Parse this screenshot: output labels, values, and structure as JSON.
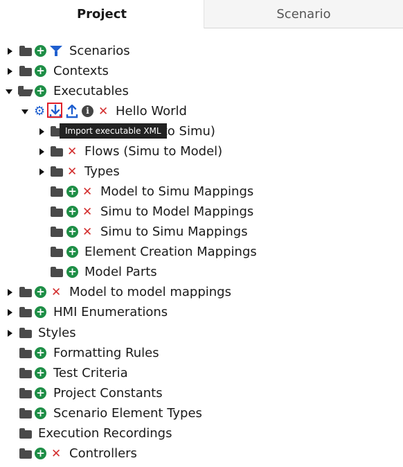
{
  "tabs": {
    "project": "Project",
    "scenario": "Scenario"
  },
  "tooltip": "Import executable XML",
  "tree": {
    "scenarios": "Scenarios",
    "contexts": "Contexts",
    "executables": "Executables",
    "hello_world": "Hello World",
    "model_to_simu_partial": "l to Simu)",
    "flows_simu_to_model": "Flows (Simu to Model)",
    "types": "Types",
    "model_to_simu_mappings": "Model to Simu Mappings",
    "simu_to_model_mappings": "Simu to Model Mappings",
    "simu_to_simu_mappings": "Simu to Simu Mappings",
    "element_creation_mappings": "Element Creation Mappings",
    "model_parts": "Model Parts",
    "model_to_model_mappings": "Model to model mappings",
    "hmi_enumerations": "HMI Enumerations",
    "styles": "Styles",
    "formatting_rules": "Formatting Rules",
    "test_criteria": "Test Criteria",
    "project_constants": "Project Constants",
    "scenario_element_types": "Scenario Element Types",
    "execution_recordings": "Execution Recordings",
    "controllers": "Controllers"
  },
  "glyphs": {
    "plus": "+",
    "cross": "✕",
    "gear": "⚙",
    "info": "i"
  },
  "colors": {
    "add": "#1e8e46",
    "delete": "#d32f2f",
    "action_blue": "#1f5fcf",
    "highlight": "#e0202a"
  },
  "icons": [
    "filter-icon",
    "gear-icon",
    "import-icon",
    "export-icon",
    "info-icon",
    "folder-icon",
    "folder-open-icon",
    "add-icon",
    "delete-icon"
  ]
}
